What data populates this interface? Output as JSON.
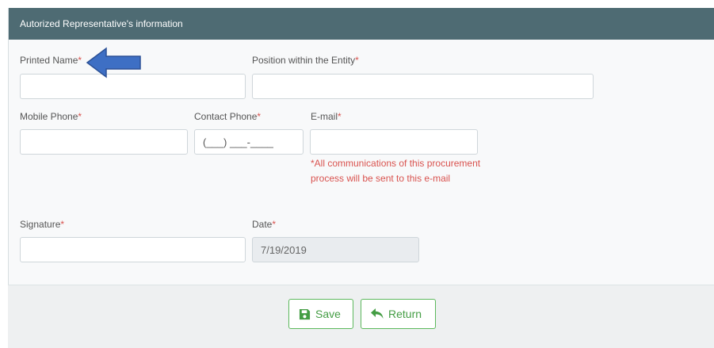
{
  "panel": {
    "title": "Autorized Representative's information"
  },
  "fields": {
    "printed_name": {
      "label": "Printed Name",
      "value": ""
    },
    "position": {
      "label": "Position within the Entity",
      "value": ""
    },
    "mobile_phone": {
      "label": "Mobile Phone",
      "value": ""
    },
    "contact_phone": {
      "label": "Contact Phone",
      "placeholder": "(___) ___-____"
    },
    "email": {
      "label": "E-mail",
      "value": "",
      "note": "*All communications of this procurement process will be sent to this e-mail"
    },
    "signature": {
      "label": "Signature",
      "value": ""
    },
    "date": {
      "label": "Date",
      "value": "7/19/2019"
    },
    "required_mark": "*"
  },
  "buttons": {
    "save": "Save",
    "return": "Return"
  },
  "colors": {
    "header": "#4e6b73",
    "required": "#d9534f",
    "button": "#449d44",
    "arrow": "#3e6fc4"
  },
  "icons": {
    "save": "floppy-disk-icon",
    "return": "reply-arrow-icon",
    "annotation": "left-arrow-icon"
  }
}
